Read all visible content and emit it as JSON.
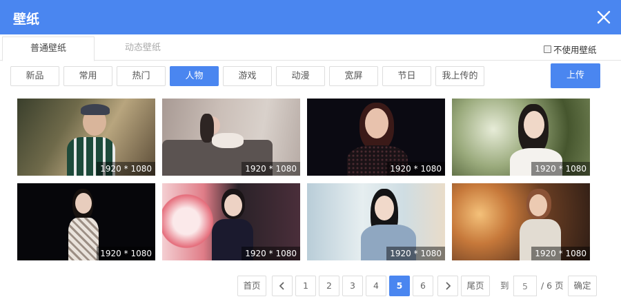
{
  "dialog": {
    "title": "壁纸"
  },
  "tabs": [
    "普通壁纸",
    "动态壁纸"
  ],
  "no_use_label": "不使用壁纸",
  "categories": [
    "新品",
    "常用",
    "热门",
    "人物",
    "游戏",
    "动漫",
    "宽屏",
    "节日",
    "我上传的"
  ],
  "active_category": "人物",
  "upload_label": "上传",
  "thumbnails": [
    {
      "resolution": "1920 * 1080"
    },
    {
      "resolution": "1920 * 1080"
    },
    {
      "resolution": "1920 * 1080"
    },
    {
      "resolution": "1920 * 1080"
    },
    {
      "resolution": "1920 * 1080"
    },
    {
      "resolution": "1920 * 1080"
    },
    {
      "resolution": "1920 * 1080"
    },
    {
      "resolution": "1920 * 1080"
    }
  ],
  "pagination": {
    "first": "首页",
    "prev_icon": "chevron-left-icon",
    "pages": [
      "1",
      "2",
      "3",
      "4",
      "5",
      "6"
    ],
    "current": "5",
    "next_icon": "chevron-right-icon",
    "last": "尾页",
    "goto_prefix": "到",
    "goto_value": "5",
    "total_suffix": "/ 6 页",
    "confirm": "确定"
  },
  "colors": {
    "accent": "#4a86f0",
    "border": "#dddddd"
  }
}
